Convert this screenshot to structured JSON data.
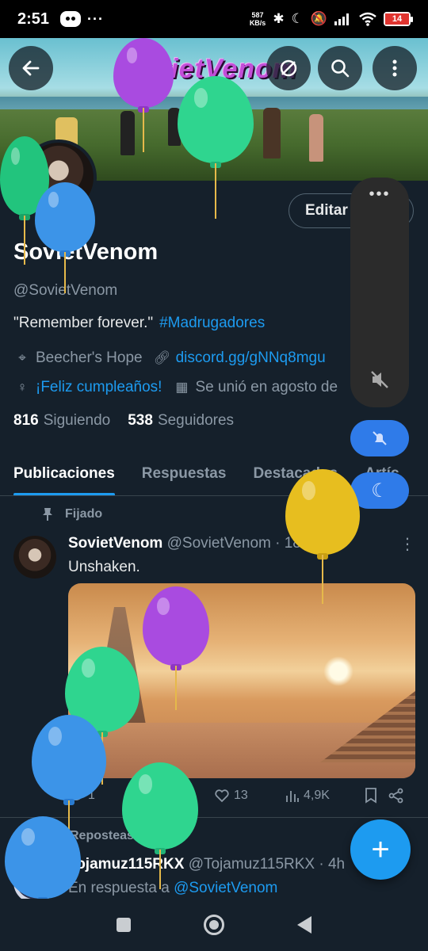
{
  "status_bar": {
    "time": "2:51",
    "more": "···",
    "speed_value": "587",
    "speed_unit": "KB/s",
    "battery": "14"
  },
  "header": {
    "banner_text": "SovietVenom"
  },
  "profile": {
    "edit_label": "Editar",
    "name": "SovietVenom",
    "handle": "@SovietVenom",
    "bio": "\"Remember forever.\"",
    "bio_hashtag": "#Madrugadores",
    "location": "Beecher's Hope",
    "website": "discord.gg/gNNq8mgu",
    "birthday": "¡Feliz cumpleaños!",
    "joined": "Se unió en agosto de",
    "following_count": "816",
    "following_label": "Siguiendo",
    "followers_count": "538",
    "followers_label": "Seguidores"
  },
  "tabs": [
    "Publicaciones",
    "Respuestas",
    "Destacados",
    "Artíc"
  ],
  "pinned_post": {
    "pinned_label": "Fijado",
    "author_name": "SovietVenom",
    "author_meta": "@SovietVenom · 18 jul 23",
    "text": "Unshaken.",
    "replies": "1",
    "likes": "13",
    "views": "4,9K"
  },
  "second_post": {
    "repost_label": "Reposteaste",
    "author_name": "Tojamuz115RKX",
    "author_meta": "@Tojamuz115RKX · 4h",
    "reply_prefix": "En respuesta a",
    "reply_handle": "@SovietVenom"
  },
  "fab": {
    "label": "+"
  },
  "colors": {
    "accent": "#1d9bf0",
    "background": "#15202b",
    "divider": "#38444d"
  }
}
